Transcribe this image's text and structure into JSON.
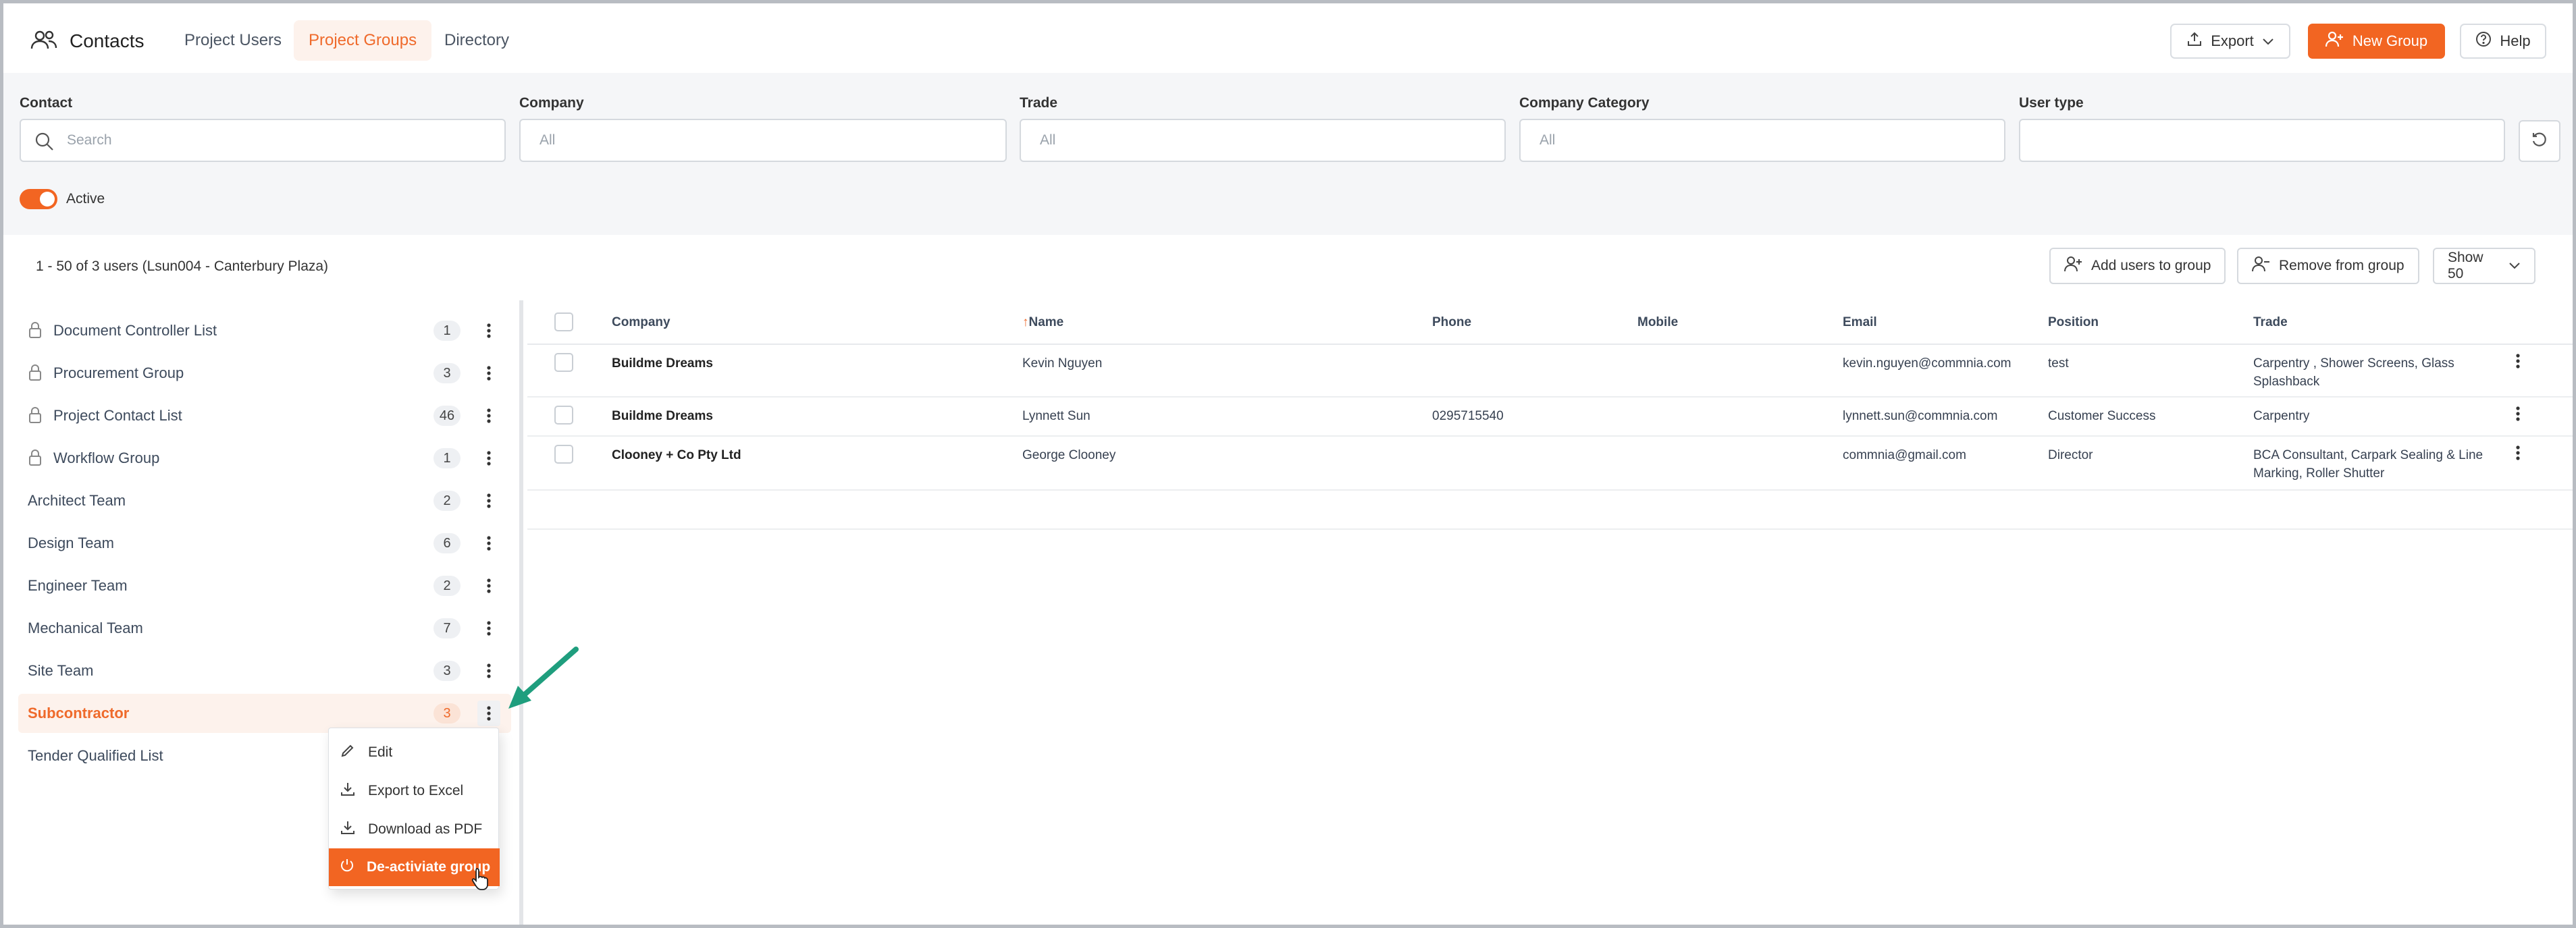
{
  "header": {
    "app_title": "Contacts",
    "tabs": [
      {
        "label": "Project Users",
        "active": false
      },
      {
        "label": "Project Groups",
        "active": true
      },
      {
        "label": "Directory",
        "active": false
      }
    ],
    "export_label": "Export",
    "new_group_label": "New Group",
    "help_label": "Help"
  },
  "filters": {
    "contact": {
      "label": "Contact",
      "placeholder": "Search"
    },
    "company": {
      "label": "Company",
      "placeholder": "All"
    },
    "trade": {
      "label": "Trade",
      "placeholder": "All"
    },
    "company_category": {
      "label": "Company Category",
      "placeholder": "All"
    },
    "user_type": {
      "label": "User type",
      "placeholder": ""
    },
    "active_toggle": {
      "label": "Active",
      "on": true
    }
  },
  "summary": {
    "text": "1 - 50 of 3 users (Lsun004 - Canterbury Plaza)",
    "add_users_label": "Add users to group",
    "remove_label": "Remove from group",
    "show_label": "Show 50"
  },
  "groups": [
    {
      "name": "Document Controller List",
      "count": "1",
      "locked": true
    },
    {
      "name": "Procurement Group",
      "count": "3",
      "locked": true
    },
    {
      "name": "Project Contact List",
      "count": "46",
      "locked": true
    },
    {
      "name": "Workflow Group",
      "count": "1",
      "locked": true
    },
    {
      "name": "Architect Team",
      "count": "2",
      "locked": false
    },
    {
      "name": "Design Team",
      "count": "6",
      "locked": false
    },
    {
      "name": "Engineer Team",
      "count": "2",
      "locked": false
    },
    {
      "name": "Mechanical Team",
      "count": "7",
      "locked": false
    },
    {
      "name": "Site Team",
      "count": "3",
      "locked": false
    },
    {
      "name": "Subcontractor",
      "count": "3",
      "locked": false,
      "active": true
    },
    {
      "name": "Tender Qualified List",
      "count": "",
      "locked": false
    }
  ],
  "context_menu": {
    "edit": "Edit",
    "export_excel": "Export to Excel",
    "download_pdf": "Download as PDF",
    "deactivate": "De-activiate group"
  },
  "table": {
    "columns": {
      "company": "Company",
      "name": "Name",
      "sort_indicator": "↑",
      "phone": "Phone",
      "mobile": "Mobile",
      "email": "Email",
      "position": "Position",
      "trade": "Trade"
    },
    "rows": [
      {
        "company": "Buildme Dreams",
        "name": "Kevin Nguyen",
        "phone": "",
        "mobile": "",
        "email": "kevin.nguyen@commnia.com",
        "position": "test",
        "trade_line1": "Carpentry , Shower Screens, Glass",
        "trade_line2": "Splashback"
      },
      {
        "company": "Buildme Dreams",
        "name": "Lynnett Sun",
        "phone": "0295715540",
        "mobile": "",
        "email": "lynnett.sun@commnia.com",
        "position": "Customer Success",
        "trade_line1": "Carpentry",
        "trade_line2": ""
      },
      {
        "company": "Clooney + Co Pty Ltd",
        "name": "George Clooney",
        "phone": "",
        "mobile": "",
        "email": "commnia@gmail.com",
        "position": "Director",
        "trade_line1": "BCA Consultant, Carpark Sealing & Line",
        "trade_line2": "Marking, Roller Shutter"
      }
    ]
  },
  "colors": {
    "accent": "#f26522",
    "annotation_arrow": "#1f9e7e"
  }
}
